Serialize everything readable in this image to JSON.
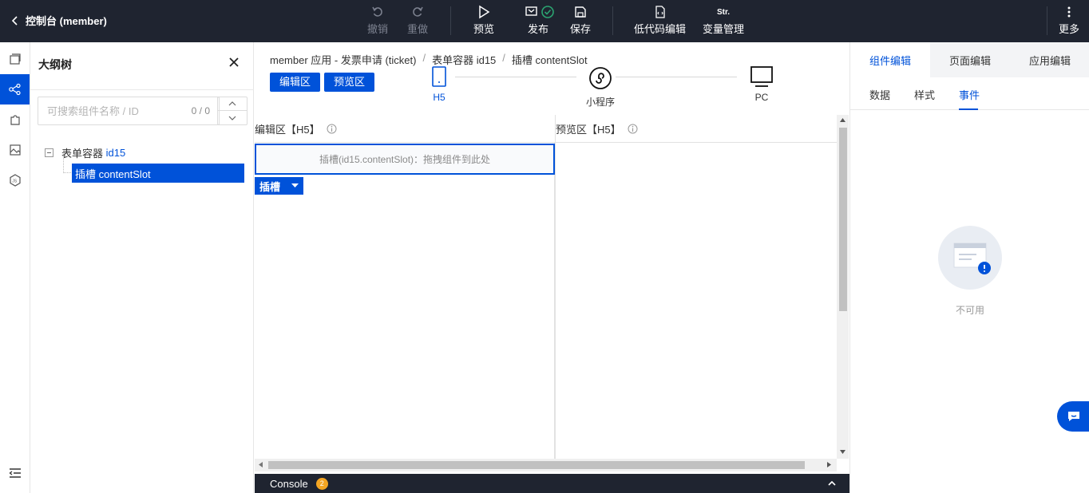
{
  "header": {
    "back_label": "控制台 (member)",
    "undo_label": "撤销",
    "redo_label": "重做",
    "preview_label": "预览",
    "publish_label": "发布",
    "save_label": "保存",
    "lowcode_label": "低代码编辑",
    "var_icon_text": "Str.",
    "var_label": "变量管理",
    "more_label": "更多"
  },
  "outline": {
    "title": "大纲树",
    "search_placeholder": "可搜索组件名称 / ID",
    "search_count": "0 / 0",
    "tree": [
      {
        "label": "表单容器",
        "id": "id15"
      },
      {
        "label": "插槽 contentSlot"
      }
    ]
  },
  "breadcrumb": [
    "member 应用 - 发票申请 (ticket)",
    "表单容器 id15",
    "插槽 contentSlot"
  ],
  "breadcrumb_sep": "/",
  "modes": {
    "edit": "编辑区",
    "preview": "预览区"
  },
  "devices": [
    {
      "label": "H5",
      "active": true
    },
    {
      "label": "小程序",
      "active": false
    },
    {
      "label": "PC",
      "active": false
    }
  ],
  "panes": {
    "edit_title": "编辑区【H5】",
    "preview_title": "预览区【H5】",
    "slot_hint": "插槽(id15.contentSlot)：拖拽组件到此处",
    "slot_tag": "插槽"
  },
  "console": {
    "label": "Console",
    "count": "2"
  },
  "right": {
    "tabs": [
      "组件编辑",
      "页面编辑",
      "应用编辑"
    ],
    "subtabs": [
      "数据",
      "样式",
      "事件"
    ],
    "empty_text": "不可用"
  },
  "colors": {
    "accent": "#0052d9",
    "topbar": "#1f2430",
    "success": "#2ba471",
    "warning": "#f5a623"
  }
}
